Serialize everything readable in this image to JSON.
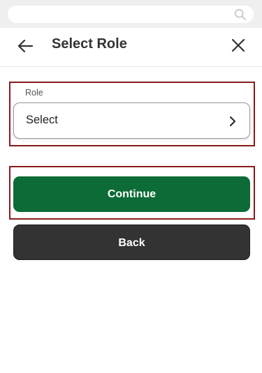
{
  "search": {
    "icon": "search-icon"
  },
  "header": {
    "title": "Select Role",
    "back_icon": "arrow-left-icon",
    "close_icon": "close-icon"
  },
  "form": {
    "role": {
      "label": "Role",
      "value": "Select",
      "icon": "chevron-right-icon"
    }
  },
  "actions": {
    "continue_label": "Continue",
    "back_label": "Back"
  },
  "colors": {
    "primary": "#0c6b36",
    "secondary": "#333333",
    "highlight": "#8a1a1a"
  }
}
